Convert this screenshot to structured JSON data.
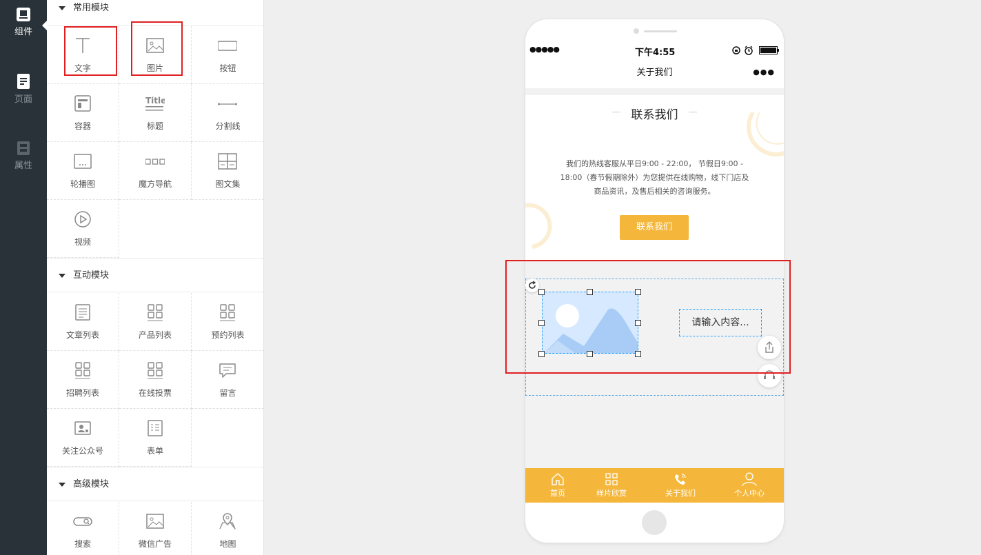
{
  "rail": {
    "components": "组件",
    "pages": "页面",
    "properties": "属性"
  },
  "sections": {
    "common": {
      "title": "常用模块",
      "items": [
        "文字",
        "图片",
        "按钮",
        "容器",
        "标题",
        "分割线",
        "轮播图",
        "魔方导航",
        "图文集",
        "视频"
      ]
    },
    "interactive": {
      "title": "互动模块",
      "items": [
        "文章列表",
        "产品列表",
        "预约列表",
        "招聘列表",
        "在线投票",
        "留言",
        "关注公众号",
        "表单"
      ]
    },
    "advanced": {
      "title": "高级模块",
      "items": [
        "搜索",
        "微信广告",
        "地图"
      ]
    }
  },
  "phone": {
    "status": {
      "signal": "●●●●●",
      "time": "下午4:55"
    },
    "nav_title": "关于我们",
    "nav_more": "●●●",
    "contact_title": "联系我们",
    "contact_text": "我们的热线客服从平日9:00 - 22:00， 节假日9:00 - 18:00（春节假期除外）为您提供在线购物，线下门店及商品资讯，及售后相关的咨询服务。",
    "contact_button": "联系我们",
    "text_placeholder": "请输入内容...",
    "tabs": [
      "首页",
      "样片欣赏",
      "关于我们",
      "个人中心"
    ]
  },
  "colors": {
    "accent": "#f5b73b",
    "highlight": "#e02020",
    "rail": "#283238",
    "selection": "#1e9fff"
  }
}
